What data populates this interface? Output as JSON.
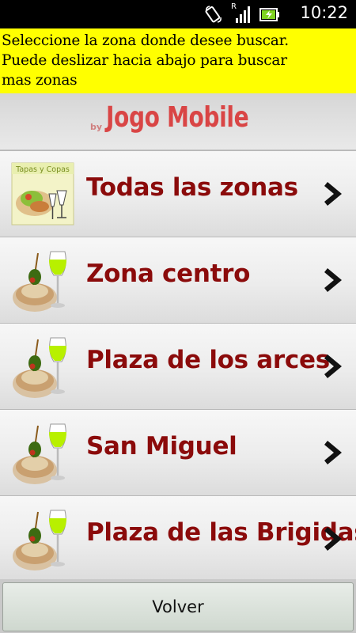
{
  "status_bar": {
    "time": "10:22",
    "roaming_indicator": "R",
    "icons": [
      "screen-rotate-icon",
      "signal-icon",
      "battery-charging-icon"
    ]
  },
  "banner": {
    "text": "Seleccione la zona donde desee buscar.\nPuede deslizar hacia abajo para buscar\nmas zonas"
  },
  "brand": {
    "by": "by",
    "name": "Jogo Mobile"
  },
  "zones": [
    {
      "label": "Todas las zonas",
      "icon": "tapas-y-copas-logo",
      "logo_text": "Tapas y Copas"
    },
    {
      "label": "Zona centro",
      "icon": "tapa-and-wine-icon"
    },
    {
      "label": "Plaza de los arces",
      "icon": "tapa-and-wine-icon"
    },
    {
      "label": "San Miguel",
      "icon": "tapa-and-wine-icon"
    },
    {
      "label": "Plaza de las Brigidas",
      "icon": "tapa-and-wine-icon"
    }
  ],
  "footer": {
    "back_label": "Volver"
  },
  "colors": {
    "banner_bg": "#ffff00",
    "brand_red": "#d94545",
    "label_red": "#8b0b0b"
  }
}
